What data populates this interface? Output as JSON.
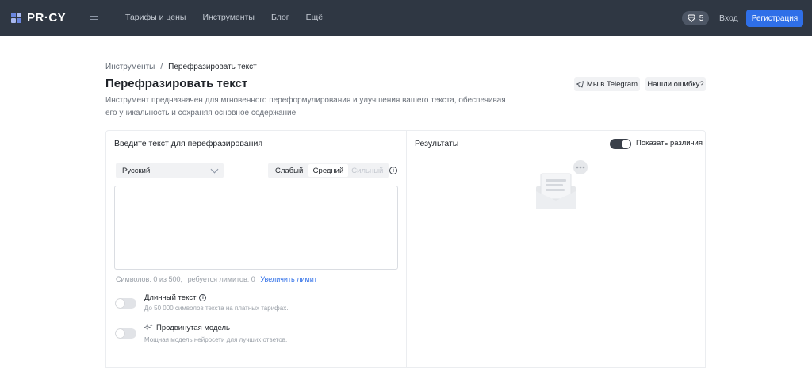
{
  "topbar": {
    "logo_text": "PR·CY",
    "nav": [
      "Тарифы и цены",
      "Инструменты",
      "Блог",
      "Ещё"
    ],
    "gems_count": "5",
    "login_label": "Вход",
    "register_label": "Регистрация"
  },
  "breadcrumb": {
    "parent": "Инструменты",
    "separator": "/",
    "current": "Перефразировать текст"
  },
  "header": {
    "title": "Перефразировать текст",
    "description": "Инструмент предназначен для мгновенного переформулирования и улучшения вашего текста, обеспечивая его уникальность и сохраняя основное содержание.",
    "telegram_label": "Мы в Telegram",
    "report_error_label": "Нашли ошибку?"
  },
  "input_panel": {
    "heading": "Введите текст для перефразирования",
    "language": "Русский",
    "levels": [
      {
        "label": "Слабый",
        "state": "normal"
      },
      {
        "label": "Средний",
        "state": "active"
      },
      {
        "label": "Сильный",
        "state": "disabled"
      }
    ],
    "text_value": "",
    "counter_text": "Символов: 0 из 500, требуется лимитов: 0",
    "increase_limit_label": "Увеличить лимит",
    "options": [
      {
        "title": "Длинный текст",
        "subtitle": "До 50 000 символов текста на платных тарифах.",
        "enabled": false
      },
      {
        "title": "Продвинутая модель",
        "subtitle": "Мощная модель нейросети для лучших ответов.",
        "enabled": false
      }
    ]
  },
  "results_panel": {
    "heading": "Результаты",
    "show_diff_label": "Показать различия",
    "show_diff_enabled": true
  },
  "colors": {
    "topbar_bg": "#2f3743",
    "accent": "#2f6fe8"
  }
}
